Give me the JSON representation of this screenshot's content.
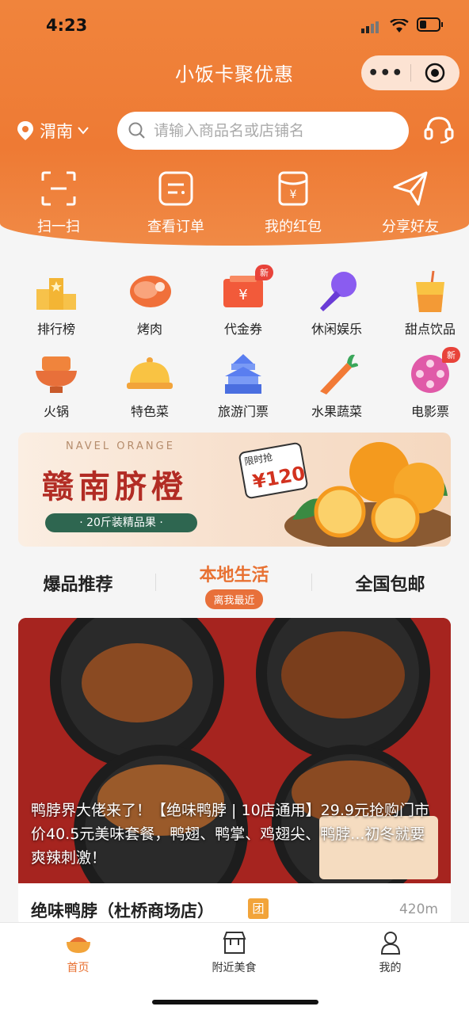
{
  "status": {
    "time": "4:23"
  },
  "header": {
    "title": "小饭卡聚优惠"
  },
  "location": {
    "city": "渭南"
  },
  "search": {
    "placeholder": "请输入商品名或店铺名"
  },
  "quick_actions": [
    {
      "label": "扫一扫",
      "icon": "scan-icon"
    },
    {
      "label": "查看订单",
      "icon": "order-icon"
    },
    {
      "label": "我的红包",
      "icon": "red-packet-icon"
    },
    {
      "label": "分享好友",
      "icon": "share-icon"
    }
  ],
  "categories": [
    {
      "label": "排行榜",
      "icon": "podium-icon"
    },
    {
      "label": "烤肉",
      "icon": "meat-icon"
    },
    {
      "label": "代金券",
      "icon": "voucher-icon",
      "badge": "新"
    },
    {
      "label": "休闲娱乐",
      "icon": "microphone-icon"
    },
    {
      "label": "甜点饮品",
      "icon": "drink-icon"
    },
    {
      "label": "火锅",
      "icon": "hotpot-icon"
    },
    {
      "label": "特色菜",
      "icon": "dish-cover-icon"
    },
    {
      "label": "旅游门票",
      "icon": "temple-icon"
    },
    {
      "label": "水果蔬菜",
      "icon": "carrot-icon"
    },
    {
      "label": "电影票",
      "icon": "film-reel-icon",
      "badge": "新"
    }
  ],
  "banner": {
    "subtitle": "NAVEL ORANGE",
    "title": "赣南脐橙",
    "pill": "· 20斤装精品果 ·",
    "price_label": "限时抢",
    "price": "¥120"
  },
  "tabs": [
    {
      "label": "爆品推荐"
    },
    {
      "label": "本地生活",
      "sub": "离我最近"
    },
    {
      "label": "全国包邮"
    }
  ],
  "card": {
    "description": "鸭脖界大佬来了！【绝味鸭脖 | 10店通用】29.9元抢购门市价40.5元美味套餐，鸭翅、鸭掌、鸡翅尖、鸭脖...初冬就要爽辣刺激！",
    "shop_name": "绝味鸭脖（杜桥商场店）",
    "group_tag": "团",
    "distance": "420m"
  },
  "bottom_nav": [
    {
      "label": "首页",
      "icon": "bowl-icon"
    },
    {
      "label": "附近美食",
      "icon": "store-icon"
    },
    {
      "label": "我的",
      "icon": "person-icon"
    }
  ],
  "colors": {
    "brand": "#ee7a34",
    "accent": "#e87132"
  }
}
